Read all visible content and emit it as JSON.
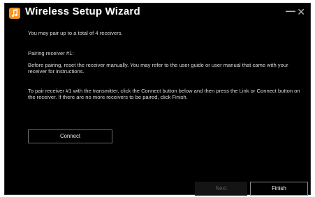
{
  "window": {
    "title": "Wireless Setup Wizard",
    "minimize_glyph": "—",
    "close_glyph": "✕"
  },
  "content": {
    "limit_text": "You may pair up to a total of 4 receivers.",
    "pairing_heading": "Pairing receiver #1:",
    "before_text": "Before pairing, reset the receiver manually. You may refer to the user guide or user manual that came with your receiver for instructions.",
    "instructions_text": "To pair receiver #1 with the transmitter, click the Connect button below and then press the Link or Connect button on the receiver. If there are no more receivers to be paired, click Finish."
  },
  "buttons": {
    "connect": "Connect",
    "next": "Next",
    "finish": "Finish"
  },
  "colors": {
    "background": "#000000",
    "accent_icon": "#f7941d",
    "text": "#dcdcdc"
  }
}
